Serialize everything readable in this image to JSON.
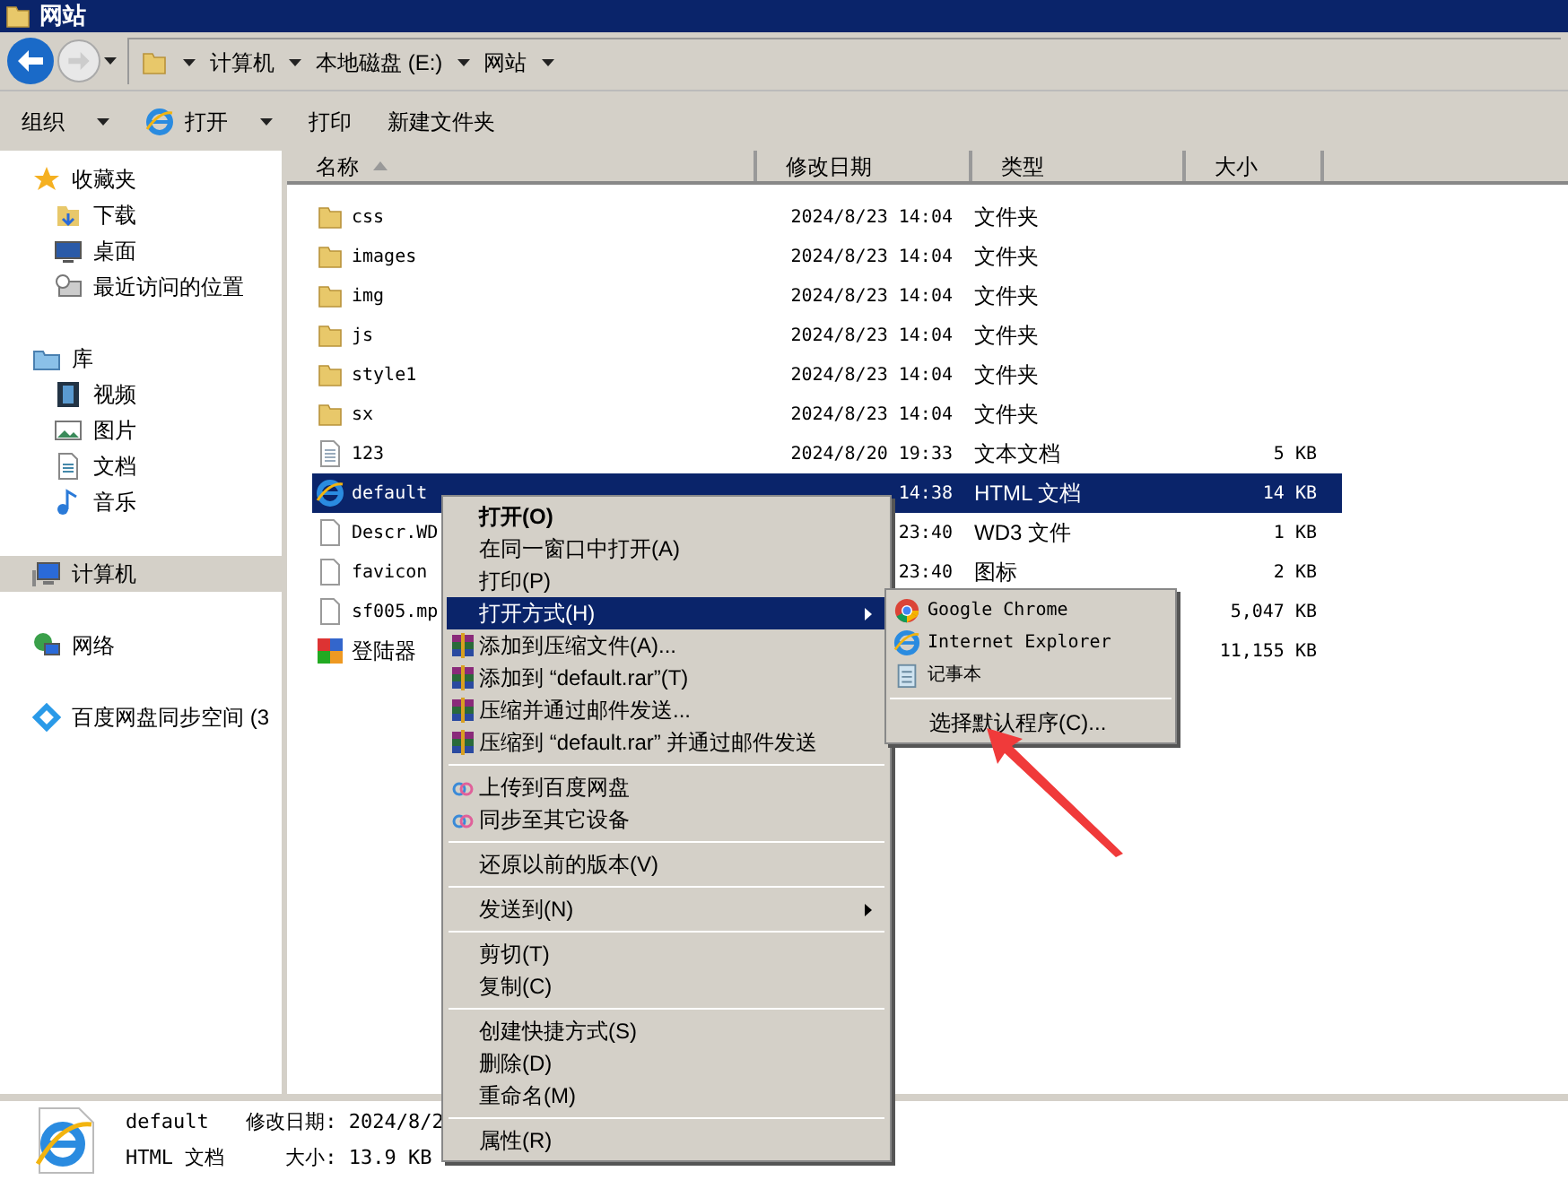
{
  "window": {
    "title": "网站"
  },
  "breadcrumb": [
    "计算机",
    "本地磁盘 (E:)",
    "网站"
  ],
  "toolbar": [
    {
      "label": "组织",
      "dropdown": true,
      "kind": "plain"
    },
    {
      "label": "打开",
      "dropdown": true,
      "kind": "browser"
    },
    {
      "label": "打印",
      "dropdown": false,
      "kind": "plain"
    },
    {
      "label": "新建文件夹",
      "dropdown": false,
      "kind": "plain"
    }
  ],
  "sidebar": {
    "groups": [
      {
        "label": "收藏夹",
        "kind": "favorites",
        "selected": false,
        "children": [
          {
            "label": "下载",
            "kind": "download",
            "selected": false
          },
          {
            "label": "桌面",
            "kind": "desktop",
            "selected": false
          },
          {
            "label": "最近访问的位置",
            "kind": "recent",
            "selected": false
          }
        ]
      },
      {
        "label": "库",
        "kind": "library",
        "selected": false,
        "children": [
          {
            "label": "视频",
            "kind": "video",
            "selected": false
          },
          {
            "label": "图片",
            "kind": "picture",
            "selected": false
          },
          {
            "label": "文档",
            "kind": "document",
            "selected": false
          },
          {
            "label": "音乐",
            "kind": "music",
            "selected": false
          }
        ]
      },
      {
        "label": "计算机",
        "kind": "computer",
        "selected": true
      },
      {
        "label": "网络",
        "kind": "network",
        "selected": false
      },
      {
        "label": "百度网盘同步空间 (3",
        "kind": "sync",
        "selected": false
      }
    ]
  },
  "table": {
    "columns": [
      "名称",
      "修改日期",
      "类型",
      "大小"
    ],
    "rows": [
      {
        "name": "css",
        "date": "2024/8/23 14:04",
        "type": "文件夹",
        "kind": "folder",
        "selected": false
      },
      {
        "name": "images",
        "date": "2024/8/23 14:04",
        "type": "文件夹",
        "kind": "folder",
        "selected": false
      },
      {
        "name": "img",
        "date": "2024/8/23 14:04",
        "type": "文件夹",
        "kind": "folder",
        "selected": false
      },
      {
        "name": "js",
        "date": "2024/8/23 14:04",
        "type": "文件夹",
        "kind": "folder",
        "selected": false
      },
      {
        "name": "style1",
        "date": "2024/8/23 14:04",
        "type": "文件夹",
        "kind": "folder",
        "selected": false
      },
      {
        "name": "sx",
        "date": "2024/8/23 14:04",
        "type": "文件夹",
        "kind": "folder",
        "selected": false
      },
      {
        "name": "123",
        "date": "2024/8/20 19:33",
        "type": "文本文档",
        "size": "5 KB",
        "kind": "text",
        "selected": false
      },
      {
        "name": "default",
        "date": "14:38",
        "type": "HTML 文档",
        "size": "14 KB",
        "kind": "html",
        "selected": true
      },
      {
        "name": "Descr.WD",
        "date": "23:40",
        "type": "WD3 文件",
        "size": "1 KB",
        "kind": "blank",
        "selected": false
      },
      {
        "name": "favicon",
        "date": "23:40",
        "type": "图标",
        "size": "2 KB",
        "kind": "blank",
        "selected": false
      },
      {
        "name": "sf005.mp",
        "size": "5,047 KB",
        "kind": "blank",
        "selected": false
      },
      {
        "name": "登陆器",
        "size": "11,155 KB",
        "kind": "app",
        "selected": false
      }
    ]
  },
  "context_menu": {
    "groups": [
      [
        {
          "label": "打开(O)",
          "kind": "plain",
          "default": true,
          "selected": false,
          "submenu": false
        },
        {
          "label": "在同一窗口中打开(A)",
          "kind": "plain",
          "default": false,
          "selected": false,
          "submenu": false
        },
        {
          "label": "打印(P)",
          "kind": "plain",
          "default": false,
          "selected": false,
          "submenu": false
        },
        {
          "label": "打开方式(H)",
          "kind": "plain",
          "default": false,
          "selected": true,
          "submenu": true
        },
        {
          "label": "添加到压缩文件(A)...",
          "kind": "archive",
          "default": false,
          "selected": false,
          "submenu": false
        },
        {
          "label": "添加到 “default.rar”(T)",
          "kind": "archive",
          "default": false,
          "selected": false,
          "submenu": false
        },
        {
          "label": "压缩并通过邮件发送...",
          "kind": "archive",
          "default": false,
          "selected": false,
          "submenu": false
        },
        {
          "label": "压缩到 “default.rar” 并通过邮件发送",
          "kind": "archive",
          "default": false,
          "selected": false,
          "submenu": false
        }
      ],
      [
        {
          "label": "上传到百度网盘",
          "kind": "cloud",
          "default": false,
          "selected": false,
          "submenu": false
        },
        {
          "label": "同步至其它设备",
          "kind": "cloud",
          "default": false,
          "selected": false,
          "submenu": false
        }
      ],
      [
        {
          "label": "还原以前的版本(V)",
          "kind": "plain",
          "default": false,
          "selected": false,
          "submenu": false
        }
      ],
      [
        {
          "label": "发送到(N)",
          "kind": "plain",
          "default": false,
          "selected": false,
          "submenu": true
        }
      ],
      [
        {
          "label": "剪切(T)",
          "kind": "plain",
          "default": false,
          "selected": false,
          "submenu": false
        },
        {
          "label": "复制(C)",
          "kind": "plain",
          "default": false,
          "selected": false,
          "submenu": false
        }
      ],
      [
        {
          "label": "创建快捷方式(S)",
          "kind": "plain",
          "default": false,
          "selected": false,
          "submenu": false
        },
        {
          "label": "删除(D)",
          "kind": "plain",
          "default": false,
          "selected": false,
          "submenu": false
        },
        {
          "label": "重命名(M)",
          "kind": "plain",
          "default": false,
          "selected": false,
          "submenu": false
        }
      ],
      [
        {
          "label": "属性(R)",
          "kind": "plain",
          "default": false,
          "selected": false,
          "submenu": false
        }
      ]
    ]
  },
  "submenu": {
    "groups": [
      [
        {
          "label": "Google Chrome",
          "kind": "chrome"
        },
        {
          "label": "Internet Explorer",
          "kind": "ie"
        },
        {
          "label": "记事本",
          "kind": "notepad"
        }
      ],
      [
        {
          "label": "选择默认程序(C)...",
          "kind": "plain"
        }
      ]
    ]
  },
  "details": {
    "name": "default",
    "modified": "修改日期: 2024/8/2",
    "type": "HTML 文档",
    "size": "大小: 13.9 KB"
  }
}
